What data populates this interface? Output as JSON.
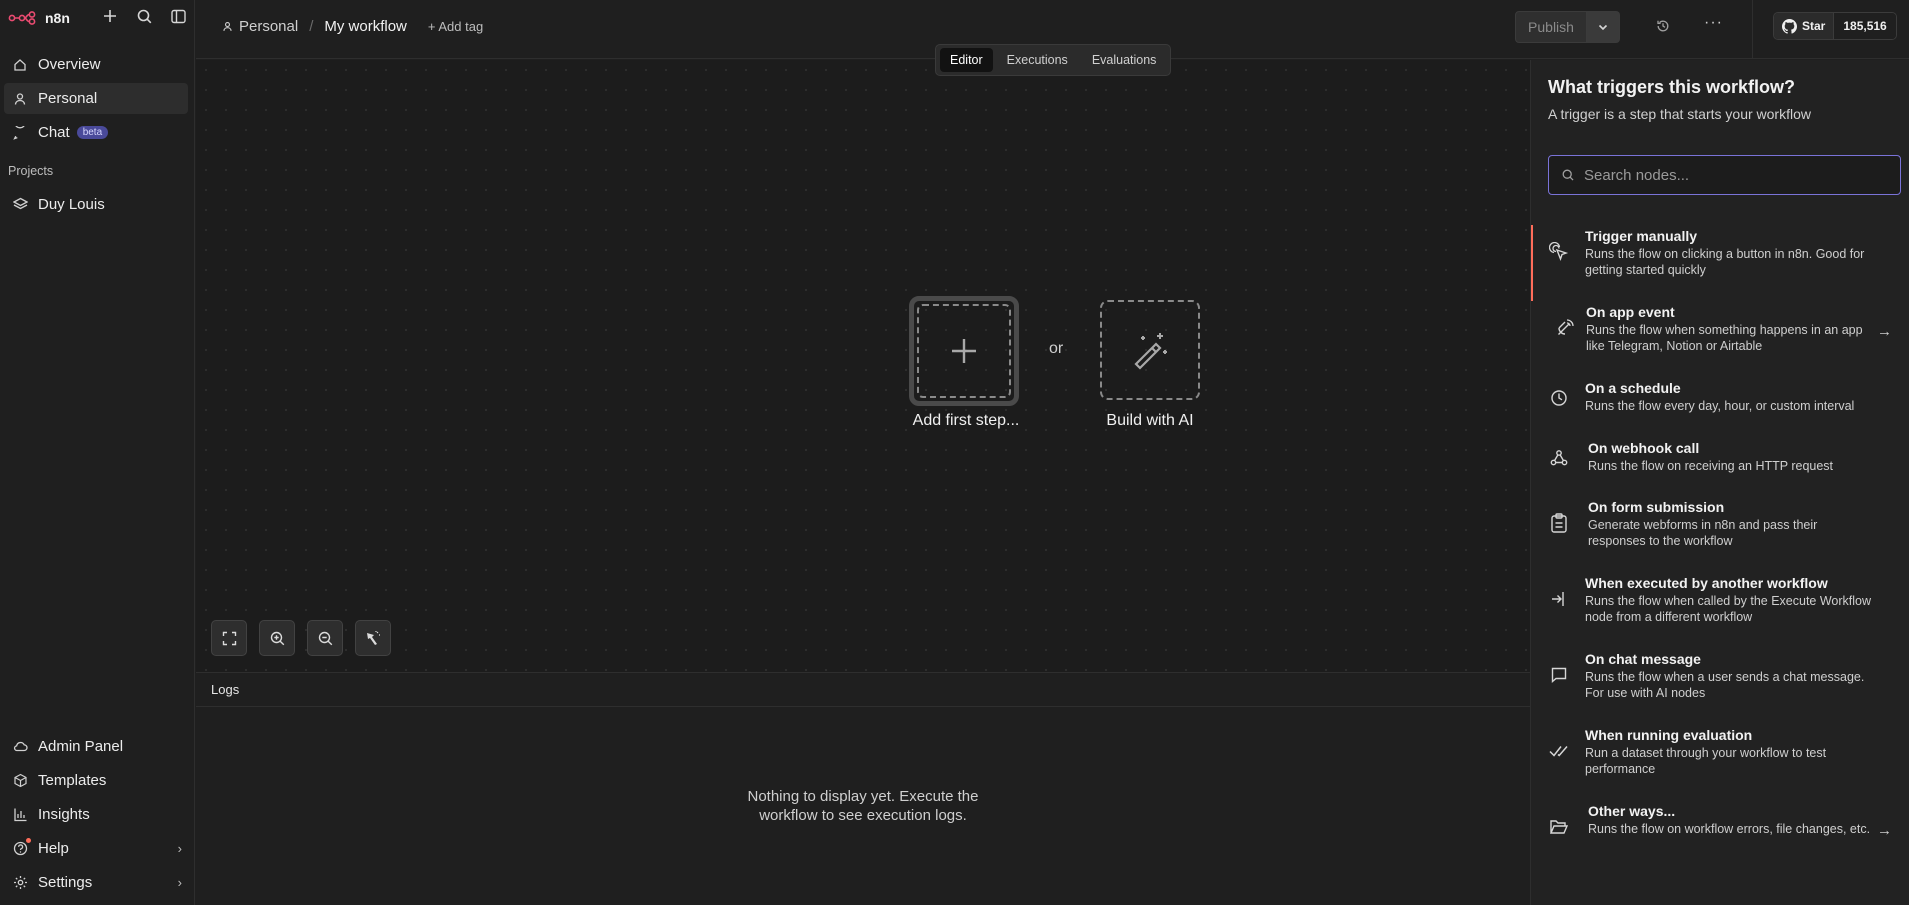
{
  "app": {
    "brand": "n8n",
    "accent": "#ff6d5a"
  },
  "sidebar": {
    "items": [
      {
        "label": "Overview",
        "icon": "home-icon"
      },
      {
        "label": "Personal",
        "icon": "user-icon"
      },
      {
        "label": "Chat",
        "icon": "chat-icon",
        "badge": "beta"
      }
    ],
    "projects_title": "Projects",
    "projects": [
      {
        "label": "Duy Louis",
        "icon": "layers-icon"
      }
    ],
    "bottom_items": [
      {
        "label": "Admin Panel",
        "icon": "cloud-icon"
      },
      {
        "label": "Templates",
        "icon": "box-icon"
      },
      {
        "label": "Insights",
        "icon": "chart-icon"
      },
      {
        "label": "Help",
        "icon": "help-icon"
      },
      {
        "label": "Settings",
        "icon": "gear-icon"
      }
    ]
  },
  "header": {
    "breadcrumb_personal": "Personal",
    "breadcrumb_separator": "/",
    "workflow_name": "My workflow",
    "add_tag": "+ Add tag",
    "publish_label": "Publish",
    "github_star": "Star",
    "github_count": "185,516"
  },
  "tabs": [
    {
      "label": "Editor",
      "active": true
    },
    {
      "label": "Executions"
    },
    {
      "label": "Evaluations"
    }
  ],
  "canvas": {
    "add_first_step": "Add first step...",
    "or_text": "or",
    "build_with_ai": "Build with AI"
  },
  "logs": {
    "title": "Logs",
    "empty_line1": "Nothing to display yet. Execute the",
    "empty_line2": "workflow to see execution logs."
  },
  "panel": {
    "title": "What triggers this workflow?",
    "subtitle": "A trigger is a step that starts your workflow",
    "search_placeholder": "Search nodes...",
    "items": [
      {
        "title": "Trigger manually",
        "desc": "Runs the flow on clicking a button in n8n. Good for getting started quickly",
        "icon": "cursor-click-icon"
      },
      {
        "title": "On app event",
        "desc": "Runs the flow when something happens in an app like Telegram, Notion or Airtable",
        "icon": "satellite-icon"
      },
      {
        "title": "On a schedule",
        "desc": "Runs the flow every day, hour, or custom interval",
        "icon": "clock-icon"
      },
      {
        "title": "On webhook call",
        "desc": "Runs the flow on receiving an HTTP request",
        "icon": "webhook-icon"
      },
      {
        "title": "On form submission",
        "desc": "Generate webforms in n8n and pass their responses to the workflow",
        "icon": "clipboard-icon"
      },
      {
        "title": "When executed by another workflow",
        "desc": "Runs the flow when called by the Execute Workflow node from a different workflow",
        "icon": "sign-in-icon"
      },
      {
        "title": "On chat message",
        "desc": "Runs the flow when a user sends a chat message. For use with AI nodes",
        "icon": "message-icon"
      },
      {
        "title": "When running evaluation",
        "desc": "Run a dataset through your workflow to test performance",
        "icon": "check-double-icon"
      },
      {
        "title": "Other ways...",
        "desc": "Runs the flow on workflow errors, file changes, etc.",
        "icon": "folder-open-icon"
      }
    ]
  }
}
